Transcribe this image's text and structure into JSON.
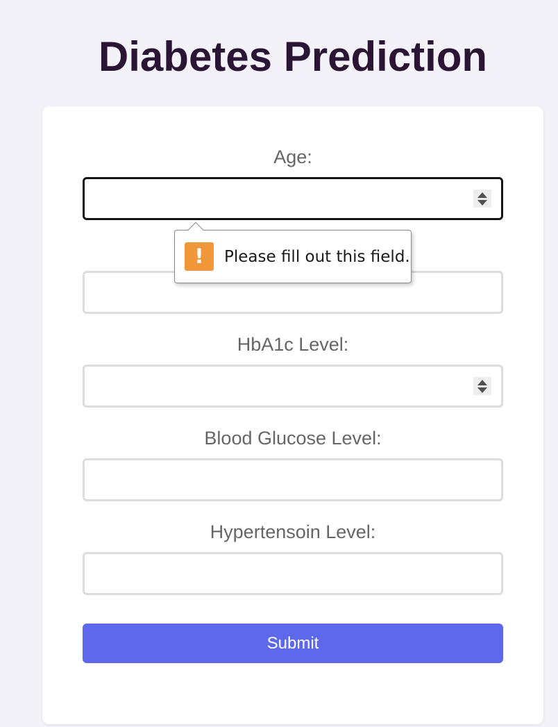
{
  "page": {
    "title": "Diabetes Prediction"
  },
  "form": {
    "fields": [
      {
        "label": "Age:",
        "value": "",
        "type": "number"
      },
      {
        "label": "",
        "value": "",
        "type": "text"
      },
      {
        "label": "HbA1c Level:",
        "value": "",
        "type": "number"
      },
      {
        "label": "Blood Glucose Level:",
        "value": "",
        "type": "text"
      },
      {
        "label": "Hypertensoin Level:",
        "value": "",
        "type": "text"
      }
    ],
    "submit_label": "Submit"
  },
  "validation": {
    "message": "Please fill out this field.",
    "icon": "warning-icon",
    "icon_glyph": "!"
  },
  "colors": {
    "background": "#f3f2f8",
    "title": "#2b1535",
    "accent": "#5d68eb",
    "warning": "#f0973a"
  }
}
